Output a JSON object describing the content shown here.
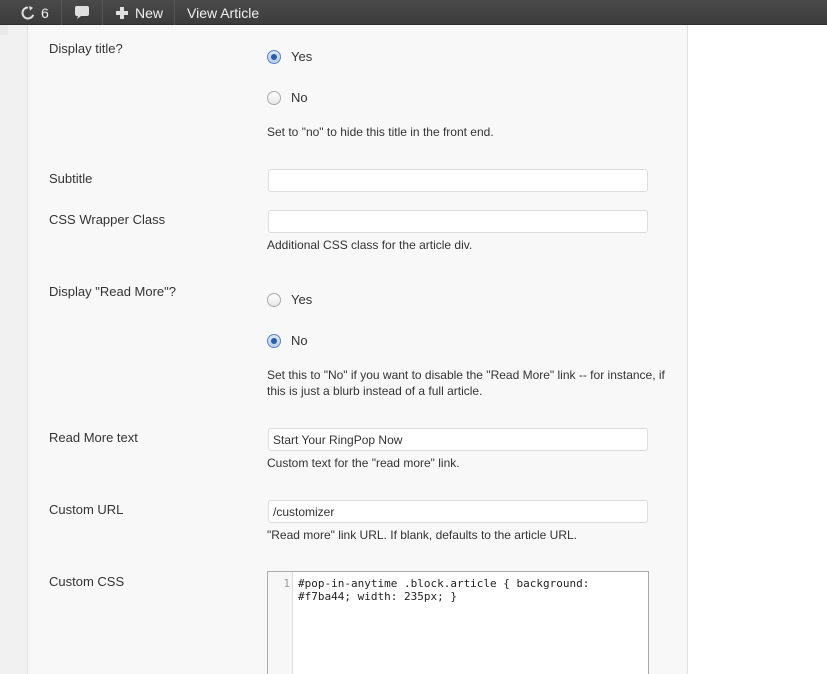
{
  "adminbar": {
    "updates_count": "6",
    "new_label": "New",
    "view_label": "View Article"
  },
  "fields": {
    "display_title": {
      "label": "Display title?",
      "options": [
        "Yes",
        "No"
      ],
      "selected": "Yes",
      "help": "Set to \"no\" to hide this title in the front end."
    },
    "subtitle": {
      "label": "Subtitle",
      "value": ""
    },
    "css_wrapper": {
      "label": "CSS Wrapper Class",
      "value": "",
      "help": "Additional CSS class for the article div."
    },
    "display_read_more": {
      "label": "Display \"Read More\"?",
      "options": [
        "Yes",
        "No"
      ],
      "selected": "No",
      "help": "Set this to \"No\" if you want to disable the \"Read More\" link -- for instance, if this is just a blurb instead of a full article."
    },
    "read_more_text": {
      "label": "Read More text",
      "value": "Start Your RingPop Now",
      "help": "Custom text for the \"read more\" link."
    },
    "custom_url": {
      "label": "Custom URL",
      "value": "/customizer",
      "help": "\"Read more\" link URL. If blank, defaults to the article URL."
    },
    "custom_css": {
      "label": "Custom CSS",
      "line_number": "1",
      "code": "#pop-in-anytime .block.article { background: #f7ba44; width: 235px; }"
    }
  }
}
